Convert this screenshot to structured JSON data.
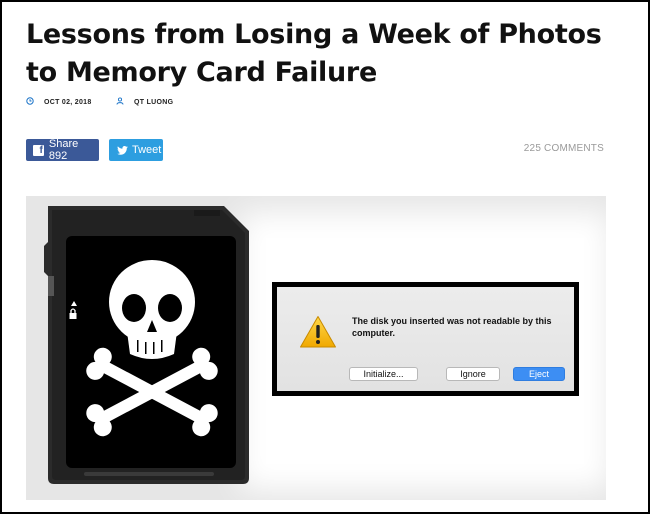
{
  "article": {
    "title": "Lessons from Losing a Week of Photos to Memory Card Failure",
    "date": "OCT 02, 2018",
    "author": "QT LUONG",
    "date_icon": "clock-icon",
    "author_icon": "person-icon"
  },
  "social": {
    "share_label": "Share 892",
    "tweet_label": "Tweet",
    "comments_label": "225 COMMENTS",
    "facebook_color": "#3b5998",
    "twitter_color": "#2d9ee0"
  },
  "figure": {
    "card_icons": [
      "skull-crossbones-icon",
      "lock-icon"
    ],
    "dialog": {
      "message": "The disk you inserted was not readable by this computer.",
      "icon": "warning-triangle-icon",
      "buttons": {
        "initialize": "Initialize...",
        "ignore": "Ignore",
        "eject": "Eject"
      },
      "default_button_color": "#3d8ef3"
    }
  },
  "colors": {
    "accent_blue": "#1a73c8",
    "figure_background": "#e6e6e6"
  }
}
